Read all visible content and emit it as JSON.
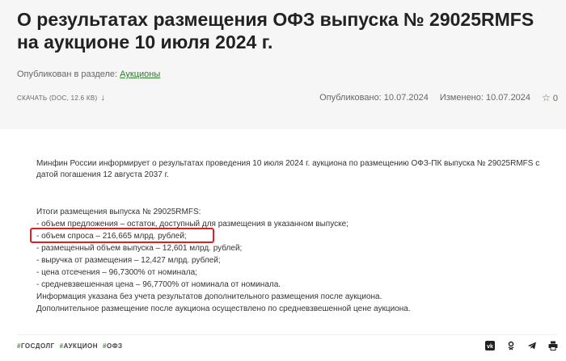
{
  "header": {
    "title": "О результатах размещения ОФЗ выпуска № 29025RMFS на аукционе 10 июля 2024 г.",
    "published_in_label": "Опубликован в разделе:",
    "published_in_link": "Аукционы",
    "download_label": "СКАЧАТЬ (DOC, 12.6 КВ)",
    "published_date": "Опубликовано: 10.07.2024",
    "modified_date": "Изменено: 10.07.2024",
    "favorites_count": "0"
  },
  "article": {
    "intro": "Минфин России информирует о результатах проведения 10 июля 2024 г. аукциона по размещению ОФЗ-ПК выпуска № 29025RMFS с датой погашения 12 августа 2037 г.",
    "results": [
      "Итоги размещения выпуска № 29025RMFS:",
      "- объем предложения – остаток, доступный для размещения в указанном выпуске;",
      "- объем спроса – 216,665 млрд. рублей;",
      "- размещенный объем выпуска – 12,601 млрд. рублей;",
      "- выручка от размещения – 12,427 млрд. рублей;",
      "- цена отсечения – 96,7300% от номинала;",
      "- средневзвешенная цена – 96,7700% от номинала от номинала.",
      "Информация указана без учета результатов дополнительного размещения после аукциона.",
      "Дополнительное размещение после аукциона осуществлено по средневзвешенной цене аукциона."
    ]
  },
  "tags": [
    "ГОСДОЛГ",
    "АУКЦИОН",
    "ОФЗ"
  ],
  "share": {
    "vk": "vk",
    "ok": "ok",
    "telegram": "tg",
    "print": "print"
  }
}
